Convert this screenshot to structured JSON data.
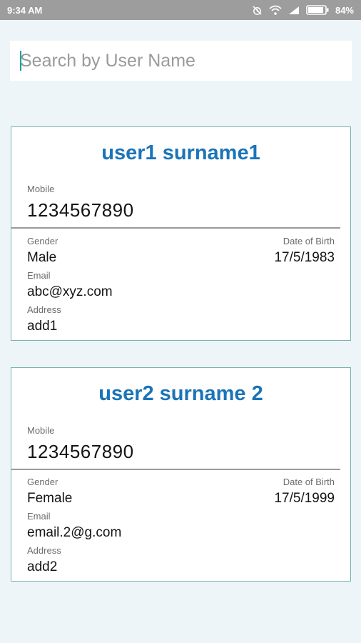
{
  "status_bar": {
    "time": "9:34 AM",
    "battery_percent": "84%",
    "icons": [
      "alarm-off-icon",
      "wifi-icon",
      "signal-icon",
      "battery-icon"
    ]
  },
  "search": {
    "placeholder": "Search by User Name",
    "value": ""
  },
  "users": [
    {
      "name": "user1 surname1",
      "mobile_label": "Mobile",
      "mobile": "1234567890",
      "gender_label": "Gender",
      "gender": "Male",
      "dob_label": "Date of Birth",
      "dob": "17/5/1983",
      "email_label": "Email",
      "email": "abc@xyz.com",
      "address_label": "Address",
      "address": "add1"
    },
    {
      "name": "user2 surname 2",
      "mobile_label": "Mobile",
      "mobile": "1234567890",
      "gender_label": "Gender",
      "gender": "Female",
      "dob_label": "Date of Birth",
      "dob": "17/5/1999",
      "email_label": "Email",
      "email": "email.2@g.com",
      "address_label": "Address",
      "address": "add2"
    }
  ],
  "colors": {
    "status_bar": "#9d9d9d",
    "page_background": "#eef5f8",
    "card_border": "#78b4b0",
    "title_blue": "#1a74b8"
  }
}
